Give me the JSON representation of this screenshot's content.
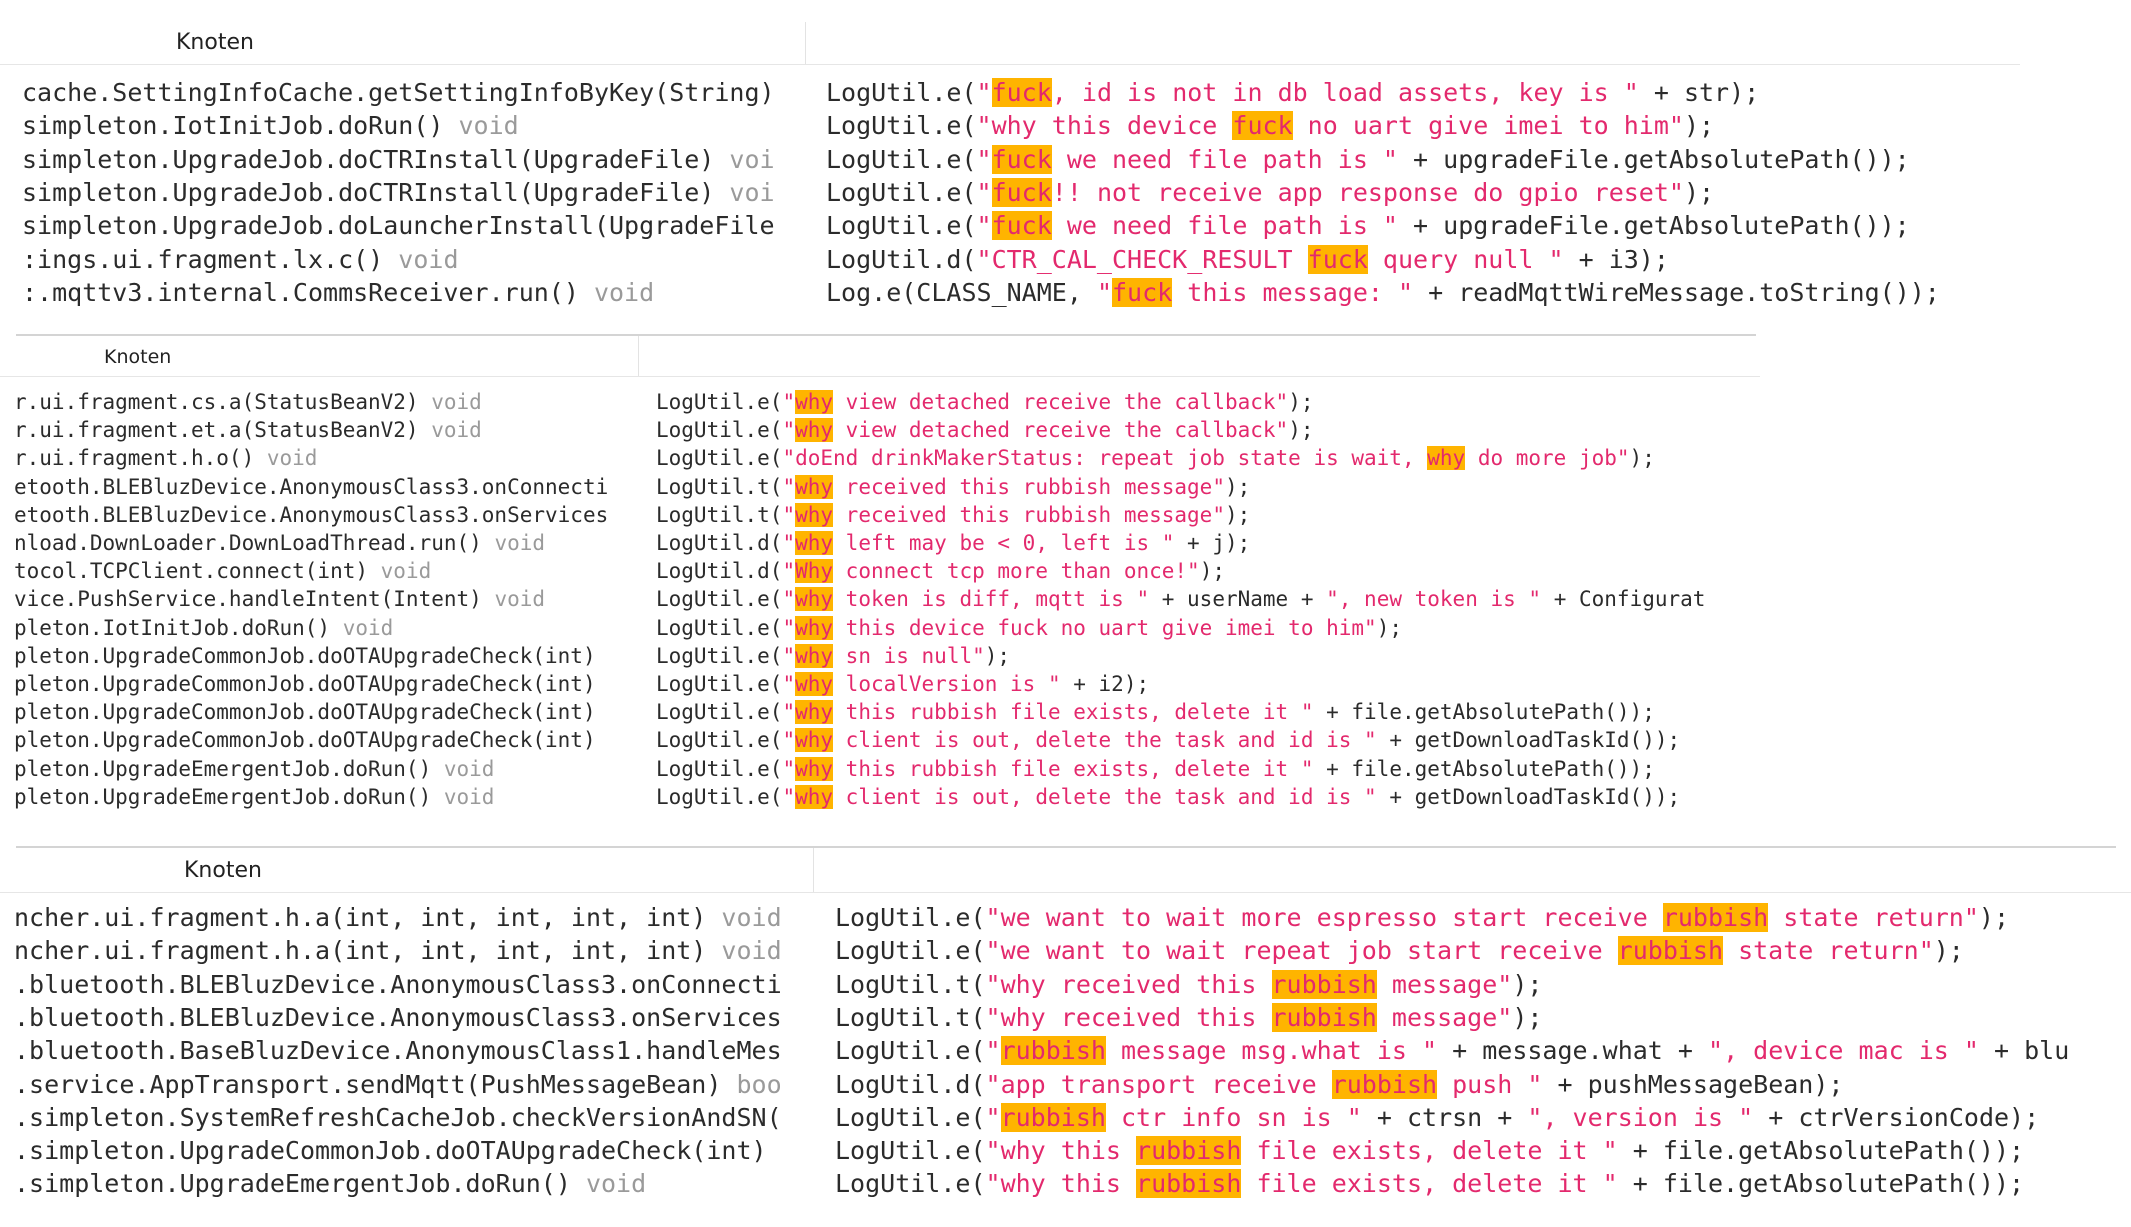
{
  "panels": [
    {
      "header": "Knoten",
      "rows": [
        {
          "method": "cache.SettingInfoCache.getSettingInfoByKey(String)",
          "ret": "",
          "code": [
            [
              "p",
              "LogUtil.e("
            ],
            [
              "s",
              "\""
            ],
            [
              "h",
              "fuck"
            ],
            [
              "s",
              ", id is not in db load assets, key is \""
            ],
            [
              "p",
              " + str);"
            ]
          ]
        },
        {
          "method": "simpleton.IotInitJob.doRun()",
          "ret": " void",
          "code": [
            [
              "p",
              "LogUtil.e("
            ],
            [
              "s",
              "\"why this device "
            ],
            [
              "h",
              "fuck"
            ],
            [
              "s",
              " no uart give imei to him\""
            ],
            [
              "p",
              ");"
            ]
          ]
        },
        {
          "method": "simpleton.UpgradeJob.doCTRInstall(UpgradeFile)",
          "ret": " voi",
          "code": [
            [
              "p",
              "LogUtil.e("
            ],
            [
              "s",
              "\""
            ],
            [
              "h",
              "fuck"
            ],
            [
              "s",
              " we need file path is \""
            ],
            [
              "p",
              " + upgradeFile.getAbsolutePath());"
            ]
          ]
        },
        {
          "method": "simpleton.UpgradeJob.doCTRInstall(UpgradeFile)",
          "ret": " voi",
          "code": [
            [
              "p",
              "LogUtil.e("
            ],
            [
              "s",
              "\""
            ],
            [
              "h",
              "fuck"
            ],
            [
              "s",
              "!! not receive app response do gpio reset\""
            ],
            [
              "p",
              ");"
            ]
          ]
        },
        {
          "method": "simpleton.UpgradeJob.doLauncherInstall(UpgradeFile",
          "ret": "",
          "code": [
            [
              "p",
              "LogUtil.e("
            ],
            [
              "s",
              "\""
            ],
            [
              "h",
              "fuck"
            ],
            [
              "s",
              " we need file path is \""
            ],
            [
              "p",
              " + upgradeFile.getAbsolutePath());"
            ]
          ]
        },
        {
          "method": ":ings.ui.fragment.lx.c()",
          "ret": " void",
          "code": [
            [
              "p",
              "LogUtil.d("
            ],
            [
              "s",
              "\"CTR_CAL_CHECK_RESULT "
            ],
            [
              "h",
              "fuck"
            ],
            [
              "s",
              " query null \""
            ],
            [
              "p",
              " + i3);"
            ]
          ]
        },
        {
          "method": ":.mqttv3.internal.CommsReceiver.run()",
          "ret": " void",
          "code": [
            [
              "p",
              "Log.e(CLASS_NAME, "
            ],
            [
              "s",
              "\""
            ],
            [
              "h",
              "fuck"
            ],
            [
              "s",
              " this message: \""
            ],
            [
              "p",
              " + readMqttWireMessage.toString());"
            ]
          ]
        }
      ]
    },
    {
      "header": "Knoten",
      "rows": [
        {
          "method": "r.ui.fragment.cs.a(StatusBeanV2)",
          "ret": " void",
          "code": [
            [
              "p",
              "LogUtil.e("
            ],
            [
              "s",
              "\""
            ],
            [
              "h",
              "why"
            ],
            [
              "s",
              " view detached receive the callback\""
            ],
            [
              "p",
              ");"
            ]
          ]
        },
        {
          "method": "r.ui.fragment.et.a(StatusBeanV2)",
          "ret": " void",
          "code": [
            [
              "p",
              "LogUtil.e("
            ],
            [
              "s",
              "\""
            ],
            [
              "h",
              "why"
            ],
            [
              "s",
              " view detached receive the callback\""
            ],
            [
              "p",
              ");"
            ]
          ]
        },
        {
          "method": "r.ui.fragment.h.o()",
          "ret": " void",
          "code": [
            [
              "p",
              "LogUtil.e("
            ],
            [
              "s",
              "\"doEnd drinkMakerStatus: repeat job state is wait, "
            ],
            [
              "h",
              "why"
            ],
            [
              "s",
              " do more job\""
            ],
            [
              "p",
              ");"
            ]
          ]
        },
        {
          "method": "etooth.BLEBluzDevice.AnonymousClass3.onConnecti",
          "ret": "",
          "code": [
            [
              "p",
              "LogUtil.t("
            ],
            [
              "s",
              "\""
            ],
            [
              "h",
              "why"
            ],
            [
              "s",
              " received this rubbish message\""
            ],
            [
              "p",
              ");"
            ]
          ]
        },
        {
          "method": "etooth.BLEBluzDevice.AnonymousClass3.onServices",
          "ret": "",
          "code": [
            [
              "p",
              "LogUtil.t("
            ],
            [
              "s",
              "\""
            ],
            [
              "h",
              "why"
            ],
            [
              "s",
              " received this rubbish message\""
            ],
            [
              "p",
              ");"
            ]
          ]
        },
        {
          "method": "nload.DownLoader.DownLoadThread.run()",
          "ret": " void",
          "code": [
            [
              "p",
              "LogUtil.d("
            ],
            [
              "s",
              "\""
            ],
            [
              "h",
              "why"
            ],
            [
              "s",
              " left may be < 0, left is \""
            ],
            [
              "p",
              " + j);"
            ]
          ]
        },
        {
          "method": "tocol.TCPClient.connect(int)",
          "ret": " void",
          "code": [
            [
              "p",
              "LogUtil.d("
            ],
            [
              "s",
              "\""
            ],
            [
              "h",
              "Why"
            ],
            [
              "s",
              " connect tcp more than once!\""
            ],
            [
              "p",
              ");"
            ]
          ]
        },
        {
          "method": "vice.PushService.handleIntent(Intent)",
          "ret": " void",
          "code": [
            [
              "p",
              "LogUtil.e("
            ],
            [
              "s",
              "\""
            ],
            [
              "h",
              "why"
            ],
            [
              "s",
              " token is diff, mqtt is \""
            ],
            [
              "p",
              " + userName + "
            ],
            [
              "s",
              "\", new token is \""
            ],
            [
              "p",
              " + Configurat"
            ]
          ]
        },
        {
          "method": "pleton.IotInitJob.doRun()",
          "ret": " void",
          "code": [
            [
              "p",
              "LogUtil.e("
            ],
            [
              "s",
              "\""
            ],
            [
              "h",
              "why"
            ],
            [
              "s",
              " this device fuck no uart give imei to him\""
            ],
            [
              "p",
              ");"
            ]
          ]
        },
        {
          "method": "pleton.UpgradeCommonJob.doOTAUpgradeCheck(int)",
          "ret": "",
          "code": [
            [
              "p",
              "LogUtil.e("
            ],
            [
              "s",
              "\""
            ],
            [
              "h",
              "why"
            ],
            [
              "s",
              " sn is null\""
            ],
            [
              "p",
              ");"
            ]
          ]
        },
        {
          "method": "pleton.UpgradeCommonJob.doOTAUpgradeCheck(int)",
          "ret": "",
          "code": [
            [
              "p",
              "LogUtil.e("
            ],
            [
              "s",
              "\""
            ],
            [
              "h",
              "why"
            ],
            [
              "s",
              " localVersion is \""
            ],
            [
              "p",
              " + i2);"
            ]
          ]
        },
        {
          "method": "pleton.UpgradeCommonJob.doOTAUpgradeCheck(int)",
          "ret": "",
          "code": [
            [
              "p",
              "LogUtil.e("
            ],
            [
              "s",
              "\""
            ],
            [
              "h",
              "why"
            ],
            [
              "s",
              " this rubbish file exists, delete it \""
            ],
            [
              "p",
              " + file.getAbsolutePath());"
            ]
          ]
        },
        {
          "method": "pleton.UpgradeCommonJob.doOTAUpgradeCheck(int)",
          "ret": "",
          "code": [
            [
              "p",
              "LogUtil.e("
            ],
            [
              "s",
              "\""
            ],
            [
              "h",
              "why"
            ],
            [
              "s",
              " client is out, delete the task and id is \""
            ],
            [
              "p",
              " + getDownloadTaskId());"
            ]
          ]
        },
        {
          "method": "pleton.UpgradeEmergentJob.doRun()",
          "ret": " void",
          "code": [
            [
              "p",
              "LogUtil.e("
            ],
            [
              "s",
              "\""
            ],
            [
              "h",
              "why"
            ],
            [
              "s",
              " this rubbish file exists, delete it \""
            ],
            [
              "p",
              " + file.getAbsolutePath());"
            ]
          ]
        },
        {
          "method": "pleton.UpgradeEmergentJob.doRun()",
          "ret": " void",
          "code": [
            [
              "p",
              "LogUtil.e("
            ],
            [
              "s",
              "\""
            ],
            [
              "h",
              "why"
            ],
            [
              "s",
              " client is out, delete the task and id is \""
            ],
            [
              "p",
              " + getDownloadTaskId());"
            ]
          ]
        }
      ]
    },
    {
      "header": "Knoten",
      "rows": [
        {
          "method": "ncher.ui.fragment.h.a(int, int, int, int, int)",
          "ret": " void",
          "code": [
            [
              "p",
              "LogUtil.e("
            ],
            [
              "s",
              "\"we want to wait more espresso start receive "
            ],
            [
              "h",
              "rubbish"
            ],
            [
              "s",
              " state return\""
            ],
            [
              "p",
              ");"
            ]
          ]
        },
        {
          "method": "ncher.ui.fragment.h.a(int, int, int, int, int)",
          "ret": " void",
          "code": [
            [
              "p",
              "LogUtil.e("
            ],
            [
              "s",
              "\"we want to wait repeat job start receive "
            ],
            [
              "h",
              "rubbish"
            ],
            [
              "s",
              " state return\""
            ],
            [
              "p",
              ");"
            ]
          ]
        },
        {
          "method": ".bluetooth.BLEBluzDevice.AnonymousClass3.onConnecti",
          "ret": "",
          "code": [
            [
              "p",
              "LogUtil.t("
            ],
            [
              "s",
              "\"why received this "
            ],
            [
              "h",
              "rubbish"
            ],
            [
              "s",
              " message\""
            ],
            [
              "p",
              ");"
            ]
          ]
        },
        {
          "method": ".bluetooth.BLEBluzDevice.AnonymousClass3.onServices",
          "ret": "",
          "code": [
            [
              "p",
              "LogUtil.t("
            ],
            [
              "s",
              "\"why received this "
            ],
            [
              "h",
              "rubbish"
            ],
            [
              "s",
              " message\""
            ],
            [
              "p",
              ");"
            ]
          ]
        },
        {
          "method": ".bluetooth.BaseBluzDevice.AnonymousClass1.handleMes",
          "ret": "",
          "code": [
            [
              "p",
              "LogUtil.e("
            ],
            [
              "s",
              "\""
            ],
            [
              "h",
              "rubbish"
            ],
            [
              "s",
              " message msg.what is \""
            ],
            [
              "p",
              " + message.what + "
            ],
            [
              "s",
              "\", device mac is \""
            ],
            [
              "p",
              " + blu"
            ]
          ]
        },
        {
          "method": ".service.AppTransport.sendMqtt(PushMessageBean)",
          "ret": " boo",
          "code": [
            [
              "p",
              "LogUtil.d("
            ],
            [
              "s",
              "\"app transport receive "
            ],
            [
              "h",
              "rubbish"
            ],
            [
              "s",
              " push \""
            ],
            [
              "p",
              " + pushMessageBean);"
            ]
          ]
        },
        {
          "method": ".simpleton.SystemRefreshCacheJob.checkVersionAndSN(",
          "ret": "",
          "code": [
            [
              "p",
              "LogUtil.e("
            ],
            [
              "s",
              "\""
            ],
            [
              "h",
              "rubbish"
            ],
            [
              "s",
              " ctr info sn is \""
            ],
            [
              "p",
              " + ctrsn + "
            ],
            [
              "s",
              "\", version is \""
            ],
            [
              "p",
              " + ctrVersionCode);"
            ]
          ]
        },
        {
          "method": ".simpleton.UpgradeCommonJob.doOTAUpgradeCheck(int)",
          "ret": "",
          "code": [
            [
              "p",
              "LogUtil.e("
            ],
            [
              "s",
              "\"why this "
            ],
            [
              "h",
              "rubbish"
            ],
            [
              "s",
              " file exists, delete it \""
            ],
            [
              "p",
              " + file.getAbsolutePath());"
            ]
          ]
        },
        {
          "method": ".simpleton.UpgradeEmergentJob.doRun()",
          "ret": " void",
          "code": [
            [
              "p",
              "LogUtil.e("
            ],
            [
              "s",
              "\"why this "
            ],
            [
              "h",
              "rubbish"
            ],
            [
              "s",
              " file exists, delete it \""
            ],
            [
              "p",
              " + file.getAbsolutePath());"
            ]
          ]
        }
      ]
    }
  ]
}
